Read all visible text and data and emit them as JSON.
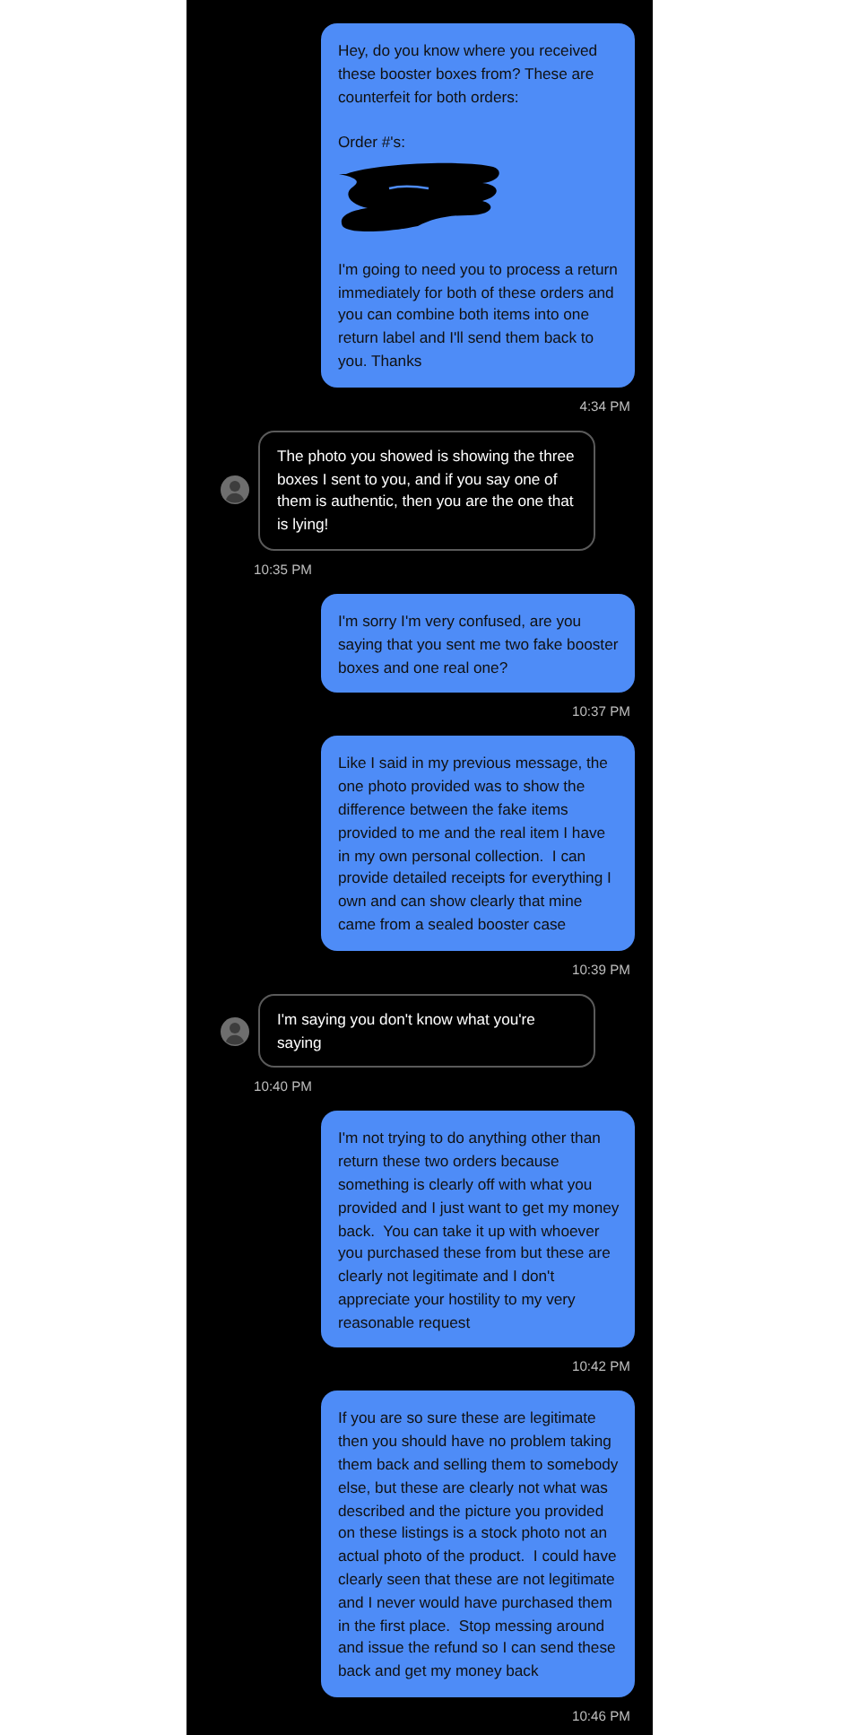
{
  "messages": [
    {
      "kind": "outgoing",
      "parts": [
        {
          "kind": "text",
          "text": "Hey, do you know where you received these booster boxes from? These are counterfeit for both orders:"
        },
        {
          "kind": "text",
          "text": "Order #'s:"
        },
        {
          "kind": "redacted"
        },
        {
          "kind": "text",
          "text": "I'm going to need you to process a return immediately for both of these orders and you can combine both items into one return label and I'll send them back to you. Thanks"
        }
      ],
      "time": "4:34 PM"
    },
    {
      "kind": "incoming",
      "parts": [
        {
          "kind": "text",
          "text": "The photo you showed is showing the three boxes I sent to you, and if you say one of them is authentic, then you are the one that is lying!"
        }
      ],
      "time": "10:35 PM"
    },
    {
      "kind": "outgoing",
      "parts": [
        {
          "kind": "text",
          "text": "I'm sorry I'm very confused, are you saying that you sent me two fake booster boxes and one real one?"
        }
      ],
      "time": "10:37 PM"
    },
    {
      "kind": "outgoing",
      "parts": [
        {
          "kind": "text",
          "text": "Like I said in my previous message, the one photo provided was to show the difference between the fake items provided to me and the real item I have in my own personal collection.  I can provide detailed receipts for everything I own and can show clearly that mine came from a sealed booster case"
        }
      ],
      "time": "10:39 PM"
    },
    {
      "kind": "incoming",
      "parts": [
        {
          "kind": "text",
          "text": "I'm saying you don't know what you're saying"
        }
      ],
      "time": "10:40 PM"
    },
    {
      "kind": "outgoing",
      "parts": [
        {
          "kind": "text",
          "text": "I'm not trying to do anything other than return these two orders because something is clearly off with what you provided and I just want to get my money back.  You can take it up with whoever you purchased these from but these are clearly not legitimate and I don't appreciate your hostility to my very reasonable request"
        }
      ],
      "time": "10:42 PM"
    },
    {
      "kind": "outgoing",
      "parts": [
        {
          "kind": "text",
          "text": "If you are so sure these are legitimate then you should have no problem taking them back and selling them to somebody else, but these are clearly not what was described and the picture you provided on these listings is a stock photo not an actual photo of the product.  I could have clearly seen that these are not legitimate and I never would have purchased them in the first place.  Stop messing around and issue the refund so I can send these back and get my money back"
        }
      ],
      "time": "10:46 PM"
    }
  ]
}
